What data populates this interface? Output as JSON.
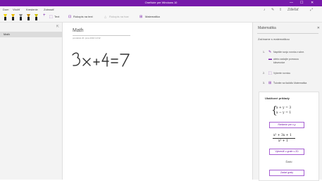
{
  "window": {
    "title": "OneNote pre Windows 10",
    "controls": [
      "—",
      "☐",
      "✕"
    ]
  },
  "menubar": {
    "items": [
      "Dom",
      "Vložiť",
      "Kreslenie",
      "Zobraziť"
    ],
    "right_icons": [
      "bell",
      "pen",
      "share",
      "expand"
    ],
    "share_label": "Zdieľať"
  },
  "toolbar": {
    "pen_colors": [
      "#f0d000",
      "#e8b800",
      "#888888",
      "#c48a00",
      "#d0c000",
      "#c0c000"
    ],
    "add_symbol": "+",
    "text_label": "Text",
    "ink_to_text_label": "Rukopis na text",
    "ink_to_shape_label": "Rukopis na tvar",
    "math_label": "Matematika"
  },
  "sidebar": {
    "pin": "⇱",
    "pages": [
      "Math"
    ]
  },
  "page": {
    "title": "Math",
    "date": "pondelok 20. júna 2016     10:32",
    "ink_text": "3x+4=7"
  },
  "math_pane": {
    "title": "Matematika",
    "close": "✕",
    "intro": "Začíname s matematikou",
    "steps": [
      {
        "num": "1.",
        "icon": "✎",
        "text": "Napíšte svoju rovnicu ručne."
      },
      {
        "num": "",
        "icon": "▬",
        "text": "alebo zadajte pomocou klávesnice"
      },
      {
        "num": "2.",
        "icon": "⬚",
        "text": "Vyberte rovnicu"
      },
      {
        "num": "3.",
        "icon": "⊞",
        "text": "Ťuknite na tlačidlo Matematika"
      }
    ],
    "examples_title": "Ukážkové príklady",
    "eq1_line1": "x + y = 3",
    "eq1_line2": "x − y = 1",
    "btn1": "Riešenie pre x,y",
    "eq2_num": "x² + 3x + 1",
    "eq2_den": "x² + 1",
    "btn2": "Vykresliť v grafe v 2D",
    "more": "Ďalší",
    "btn3": "Zadať grafy"
  }
}
